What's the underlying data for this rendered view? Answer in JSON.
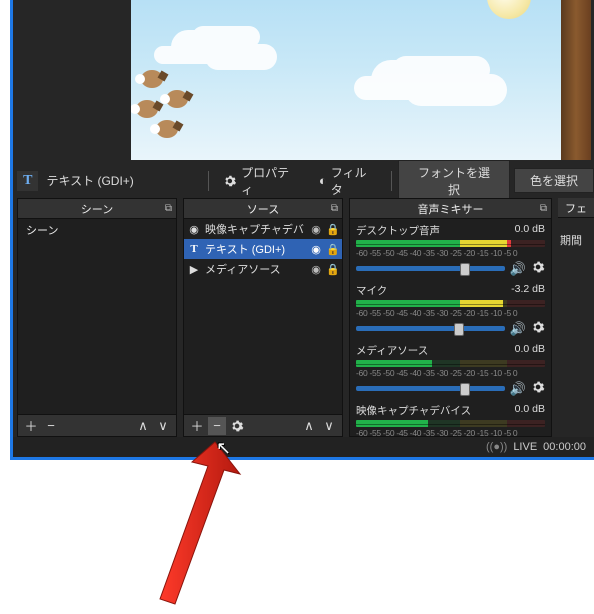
{
  "toolbar": {
    "selected_icon": "T",
    "selected_label": "テキスト (GDI+)",
    "properties_label": "プロパティ",
    "filters_label": "フィルタ",
    "font_btn": "フォントを選択",
    "color_btn": "色を選択"
  },
  "panels": {
    "scenes": {
      "title": "シーン",
      "items": [
        "シーン"
      ]
    },
    "sources": {
      "title": "ソース",
      "items": [
        {
          "icon": "camera",
          "name": "映像キャプチャデバ",
          "visible": true,
          "locked": true,
          "selected": false
        },
        {
          "icon": "text",
          "name": "テキスト (GDI+)",
          "visible": true,
          "locked": true,
          "selected": true
        },
        {
          "icon": "play",
          "name": "メディアソース",
          "visible": true,
          "locked": true,
          "selected": false
        }
      ]
    },
    "mixer": {
      "title": "音声ミキサー",
      "ticks": "-60  -55  -50  -45  -40  -35  -30  -25  -20  -15  -10  -5  0",
      "items": [
        {
          "name": "デスクトップ音声",
          "db": "0.0 dB",
          "slider": 70,
          "mask": 18
        },
        {
          "name": "マイク",
          "db": "-3.2 dB",
          "slider": 66,
          "mask": 22
        },
        {
          "name": "メディアソース",
          "db": "0.0 dB",
          "slider": 70,
          "mask": 60
        },
        {
          "name": "映像キャプチャデバイス",
          "db": "0.0 dB",
          "slider": 70,
          "mask": 62
        }
      ]
    },
    "right": {
      "title": "フェ",
      "body": "期間"
    }
  },
  "status": {
    "live_label": "LIVE",
    "time": "00:00:00"
  }
}
